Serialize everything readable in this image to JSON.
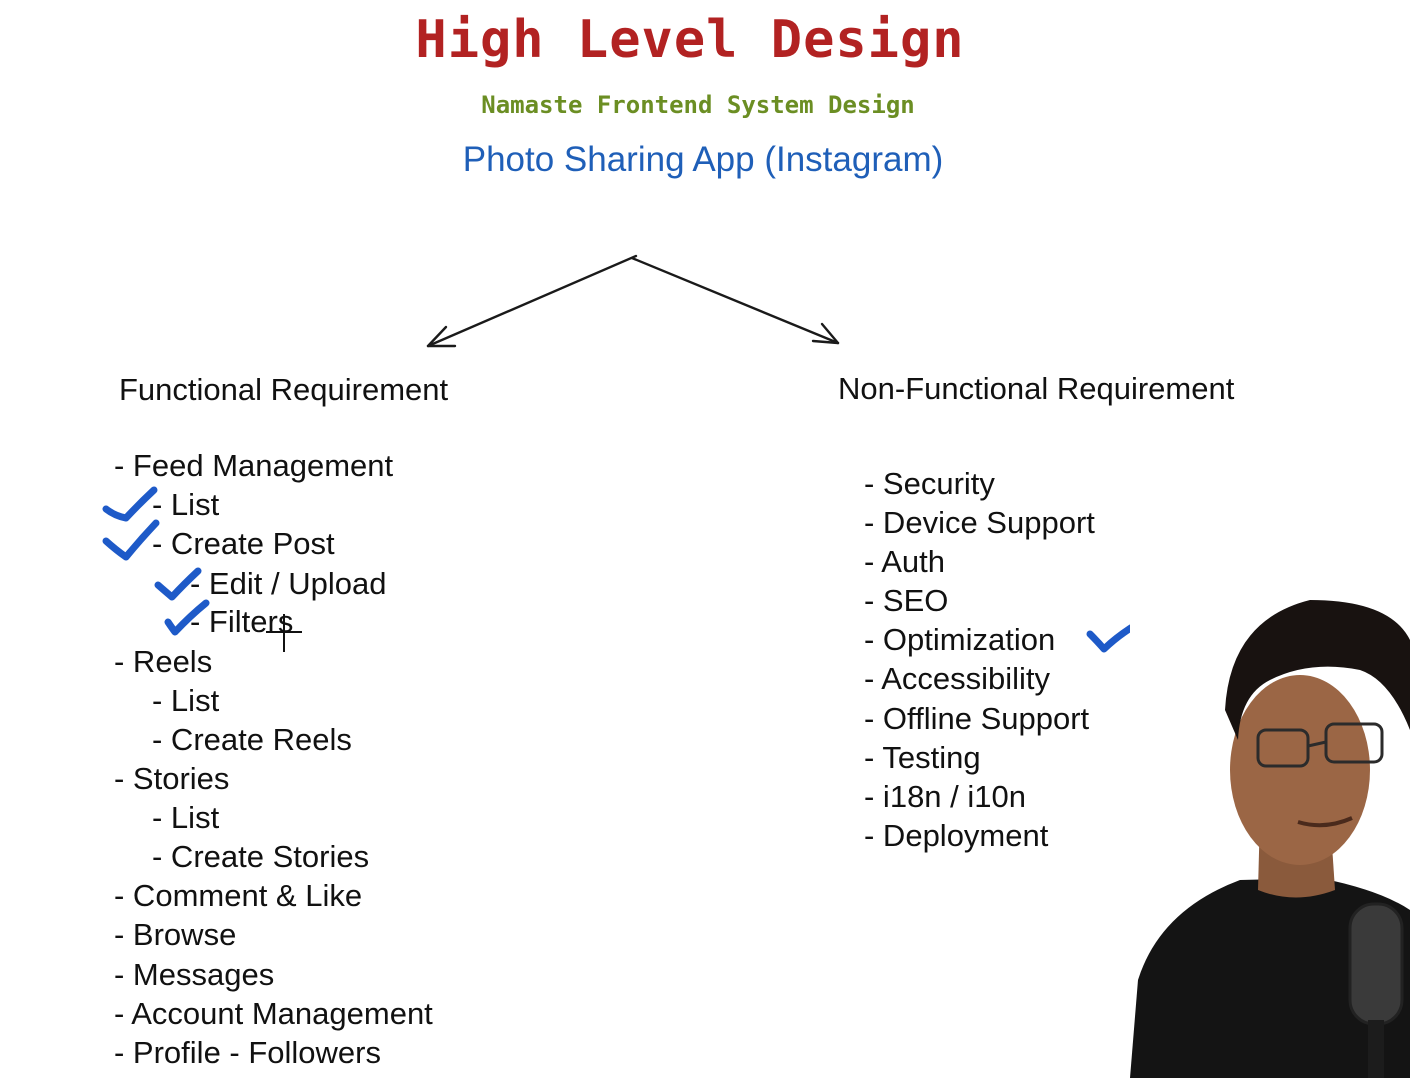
{
  "colors": {
    "title": "#b22222",
    "subtitle": "#6b8e23",
    "app_title": "#1f5fb8",
    "text": "#111111",
    "check": "#1e5ac8"
  },
  "header": {
    "title": "High Level Design",
    "subtitle": "Namaste Frontend System Design",
    "app_title": "Photo Sharing App (Instagram)"
  },
  "functional": {
    "heading": "Functional Requirement",
    "items": [
      {
        "text": "- Feed Management",
        "checked": false
      },
      {
        "text": "- List",
        "checked": true
      },
      {
        "text": "- Create Post",
        "checked": true
      },
      {
        "text": "- Edit / Upload",
        "checked": true
      },
      {
        "text": "- Filters",
        "checked": true
      },
      {
        "text": "- Reels",
        "checked": false
      },
      {
        "text": "- List",
        "checked": false
      },
      {
        "text": "- Create Reels",
        "checked": false
      },
      {
        "text": "- Stories",
        "checked": false
      },
      {
        "text": "- List",
        "checked": false
      },
      {
        "text": "- Create Stories",
        "checked": false
      },
      {
        "text": "- Comment & Like",
        "checked": false
      },
      {
        "text": "- Browse",
        "checked": false
      },
      {
        "text": "- Messages",
        "checked": false
      },
      {
        "text": "- Account Management",
        "checked": false
      },
      {
        "text": "- Profile - Followers",
        "checked": false
      }
    ]
  },
  "non_functional": {
    "heading": "Non-Functional Requirement",
    "items": [
      {
        "text": "- Security",
        "checked": false
      },
      {
        "text": "- Device Support",
        "checked": false
      },
      {
        "text": "- Auth",
        "checked": false
      },
      {
        "text": "- SEO",
        "checked": false
      },
      {
        "text": "- Optimization",
        "checked": true
      },
      {
        "text": "- Accessibility",
        "checked": false
      },
      {
        "text": "- Offline Support",
        "checked": false
      },
      {
        "text": "- Testing",
        "checked": false
      },
      {
        "text": "- i18n / i10n",
        "checked": false
      },
      {
        "text": "- Deployment",
        "checked": false
      }
    ]
  }
}
